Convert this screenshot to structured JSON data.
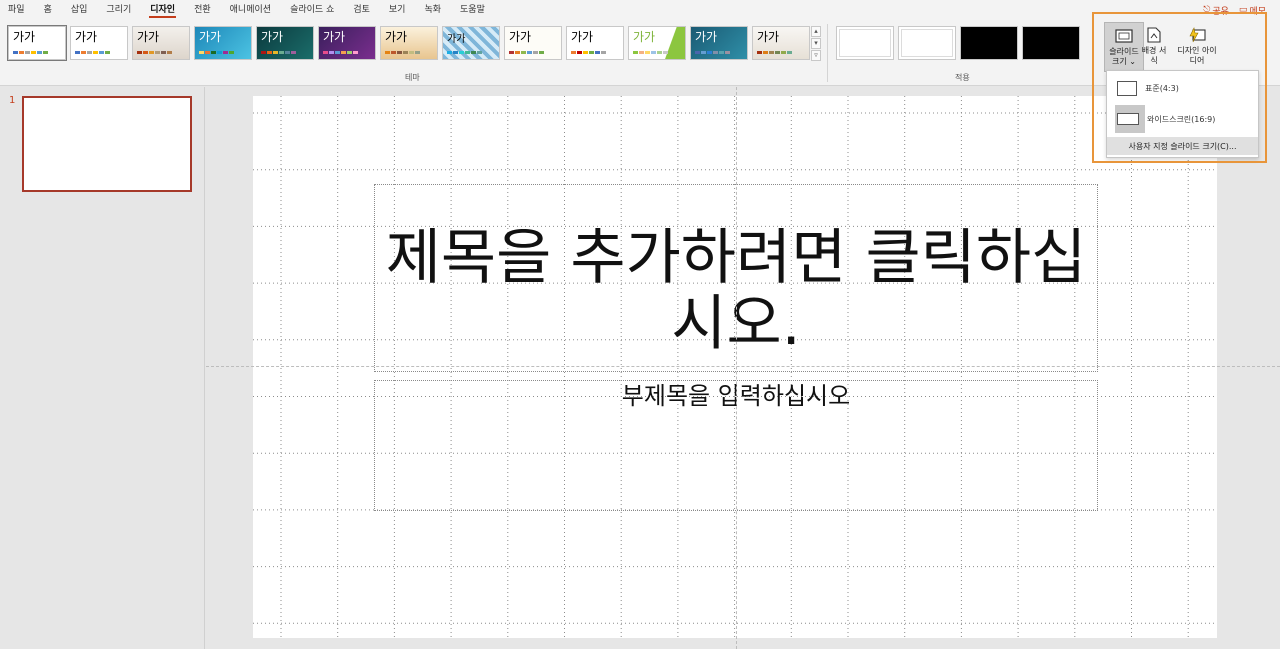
{
  "ribbon": {
    "tabs": [
      "파일",
      "홈",
      "삽입",
      "그리기",
      "디자인",
      "전환",
      "애니메이션",
      "슬라이드 쇼",
      "검토",
      "보기",
      "녹화",
      "도움말"
    ],
    "active_tab": "디자인",
    "share_label": "공유",
    "memo_label": "메모",
    "themes_group_label": "테마",
    "variants_group_label": "적용",
    "theme_sample_text": "가가",
    "slide_size_label": "슬라이드 크기",
    "bg_format_label": "배경 서식",
    "designer_label": "디자인 아이디어"
  },
  "dropdown": {
    "standard": "표준(4:3)",
    "widescreen": "와이드스크린(16:9)",
    "custom": "사용자 지정 슬라이드 크기(C)..."
  },
  "thumbnails": {
    "number": "1"
  },
  "slide": {
    "title_placeholder": "제목을 추가하려면 클릭하십시오.",
    "subtitle_placeholder": "부제목을 입력하십시오"
  },
  "colors": {
    "accent": "#c43e1c",
    "highlight": "#e8953a"
  }
}
